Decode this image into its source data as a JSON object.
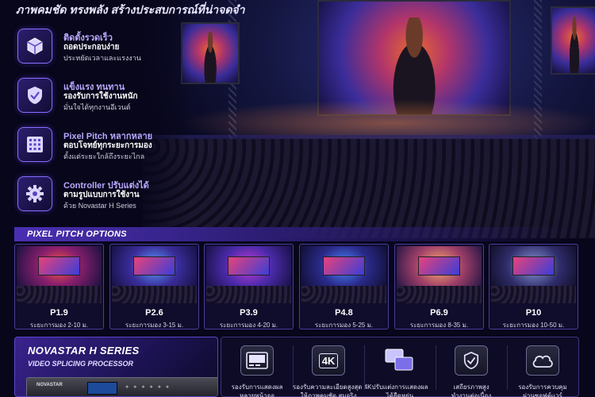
{
  "headline": "ภาพคมชัด ทรงพลัง สร้างประสบการณ์ที่น่าจดจำ",
  "features": [
    {
      "icon": "cube-icon",
      "title": "ติดตั้งรวดเร็ว",
      "subtitle": "ถอดประกอบง่าย",
      "desc": "ประหยัดเวลาและแรงงาน"
    },
    {
      "icon": "shield-check-icon",
      "title": "แข็งแรง ทนทาน",
      "subtitle": "รองรับการใช้งานหนัก",
      "desc": "มั่นใจได้ทุกงานอีเวนต์"
    },
    {
      "icon": "pixel-grid-icon",
      "title": "Pixel Pitch หลากหลาย",
      "subtitle": "ตอบโจทย์ทุกระยะการมอง",
      "desc": "ตั้งแต่ระยะใกล้ถึงระยะไกล"
    },
    {
      "icon": "gear-icon",
      "title": "Controller ปรับแต่งได้",
      "subtitle": "ตามรูปแบบการใช้งาน",
      "desc": "ด้วย Novastar H Series"
    }
  ],
  "pitch_section": {
    "title": "PIXEL PITCH OPTIONS",
    "cards": [
      {
        "label": "P1.9",
        "range": "ระยะการมอง 2-10 ม."
      },
      {
        "label": "P2.6",
        "range": "ระยะการมอง 3-15 ม."
      },
      {
        "label": "P3.9",
        "range": "ระยะการมอง 4-20 ม."
      },
      {
        "label": "P4.8",
        "range": "ระยะการมอง 5-25 ม."
      },
      {
        "label": "P6.9",
        "range": "ระยะการมอง 8-35 ม."
      },
      {
        "label": "P10",
        "range": "ระยะการมอง 10-50 ม."
      }
    ]
  },
  "novastar": {
    "title": "NOVASTAR H SERIES",
    "subtitle": "VIDEO SPLICING PROCESSOR",
    "device_brand": "NOVASTAR"
  },
  "bottom_features": [
    {
      "icon": "screen-layout-icon",
      "icon_text": "",
      "line1": "รองรับการแสดงผล",
      "line2": "หลายหน้าจอ"
    },
    {
      "icon": "4k-icon",
      "icon_text": "4K",
      "line1": "รองรับความละเอียดสูงสุด 4K",
      "line2": "ให้ภาพคมชัด สมจริง"
    },
    {
      "icon": "layers-icon",
      "icon_text": "",
      "line1": "ปรับแต่งการแสดงผล",
      "line2": "ได้ยืดหยุ่น"
    },
    {
      "icon": "shield-check-icon",
      "icon_text": "",
      "line1": "เสถียรภาพสูง",
      "line2": "ทำงานต่อเนื่อง"
    },
    {
      "icon": "cloud-icon",
      "icon_text": "",
      "line1": "รองรับการควบคุม",
      "line2": "ผ่านซอฟต์แวร์"
    }
  ],
  "colors": {
    "accent": "#8b6cff",
    "background": "#07061a",
    "panel": "#1b1250"
  }
}
